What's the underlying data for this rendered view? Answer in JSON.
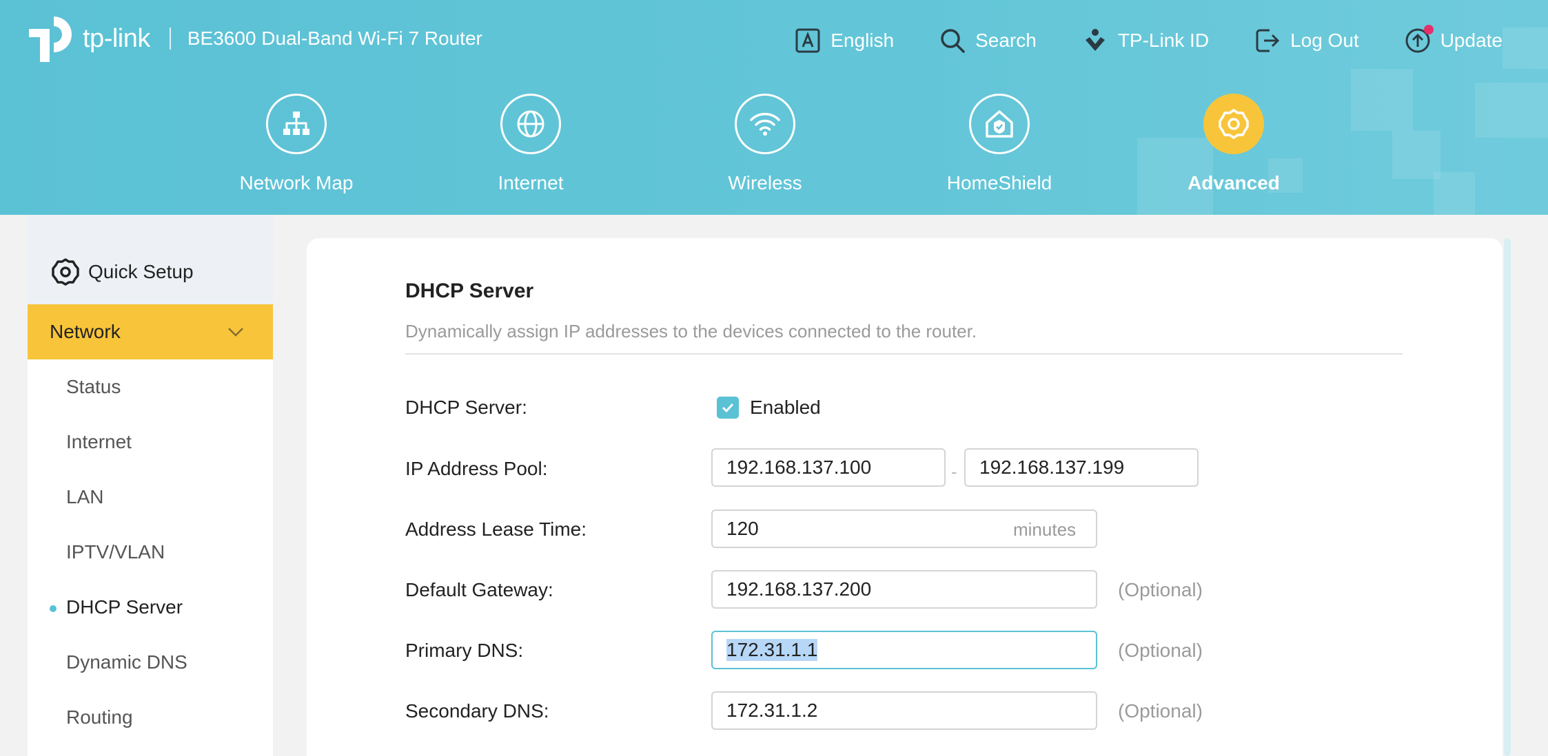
{
  "header": {
    "brand_name": "tp-link",
    "model": "BE3600 Dual-Band Wi-Fi 7 Router",
    "top_actions": [
      {
        "label": "English",
        "icon": "language-icon"
      },
      {
        "label": "Search",
        "icon": "search-icon"
      },
      {
        "label": "TP-Link ID",
        "icon": "tplink-id-icon"
      },
      {
        "label": "Log Out",
        "icon": "logout-icon"
      },
      {
        "label": "Update",
        "icon": "update-icon"
      }
    ],
    "nav": [
      {
        "label": "Network Map",
        "icon": "network-map-icon",
        "active": false
      },
      {
        "label": "Internet",
        "icon": "globe-icon",
        "active": false
      },
      {
        "label": "Wireless",
        "icon": "wifi-icon",
        "active": false
      },
      {
        "label": "HomeShield",
        "icon": "homeshield-icon",
        "active": false
      },
      {
        "label": "Advanced",
        "icon": "gear-icon",
        "active": true
      }
    ],
    "colors": {
      "header_bg": "#5bc1d5",
      "accent": "#f8c53a"
    }
  },
  "sidebar": {
    "quick_setup": "Quick Setup",
    "section": "Network",
    "items": [
      {
        "label": "Status",
        "active": false
      },
      {
        "label": "Internet",
        "active": false
      },
      {
        "label": "LAN",
        "active": false
      },
      {
        "label": "IPTV/VLAN",
        "active": false
      },
      {
        "label": "DHCP Server",
        "active": true
      },
      {
        "label": "Dynamic DNS",
        "active": false
      },
      {
        "label": "Routing",
        "active": false
      }
    ]
  },
  "main": {
    "title": "DHCP Server",
    "description": "Dynamically assign IP addresses to the devices connected to the router.",
    "dhcp_server": {
      "label": "DHCP Server:",
      "checkbox_label": "Enabled",
      "checked": true
    },
    "ip_pool": {
      "label": "IP Address Pool:",
      "start": "192.168.137.100",
      "separator": "-",
      "end": "192.168.137.199"
    },
    "lease_time": {
      "label": "Address Lease Time:",
      "value": "120",
      "unit": "minutes"
    },
    "gateway": {
      "label": "Default Gateway:",
      "value": "192.168.137.200",
      "hint": "(Optional)"
    },
    "primary_dns": {
      "label": "Primary DNS:",
      "value": "172.31.1.1",
      "hint": "(Optional)"
    },
    "secondary_dns": {
      "label": "Secondary DNS:",
      "value": "172.31.1.2",
      "hint": "(Optional)"
    }
  }
}
